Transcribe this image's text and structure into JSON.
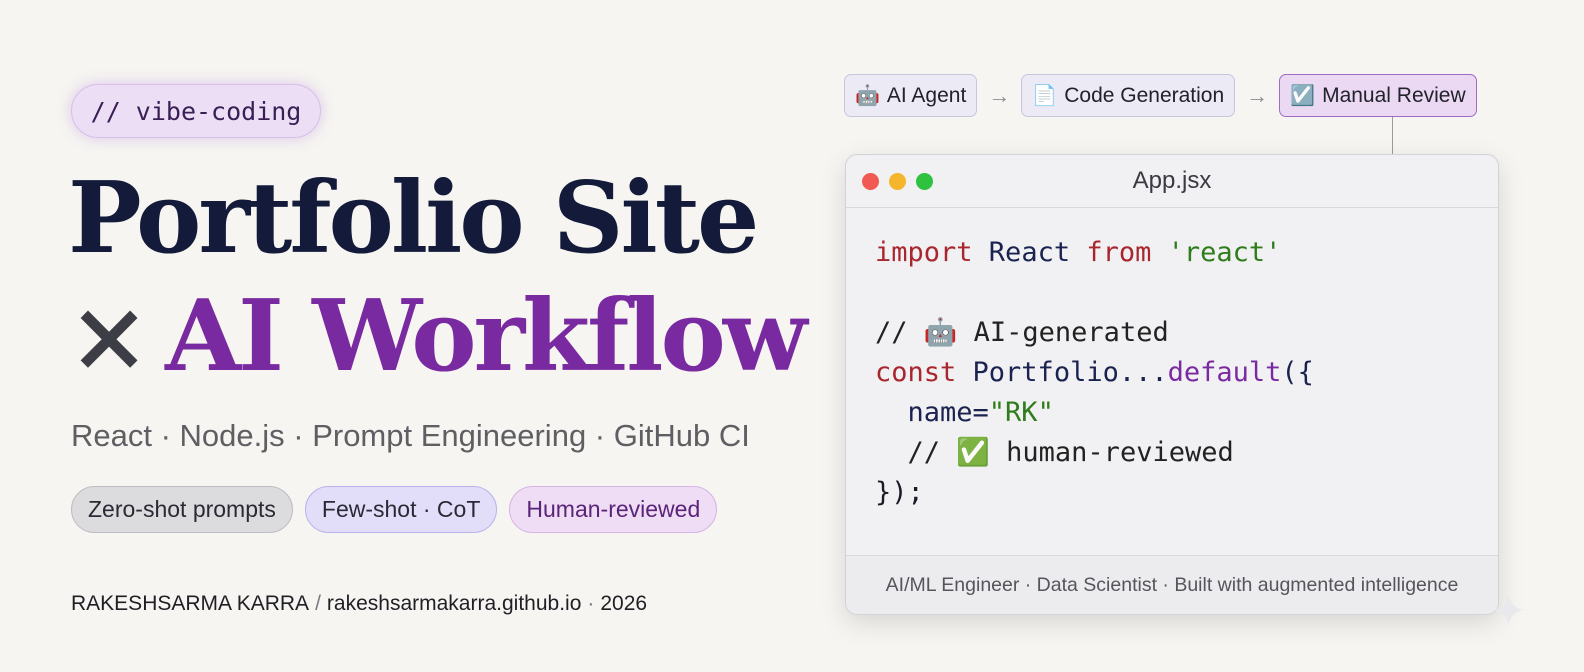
{
  "tag": "// vibe-coding",
  "title": {
    "line1": "Portfolio Site",
    "line2_prefix": "×",
    "line2_highlight": "AI Workflow"
  },
  "stack": "React · Node.js · Prompt Engineering · GitHub CI",
  "pills": [
    "Zero-shot prompts",
    "Few-shot · CoT",
    "Human-reviewed"
  ],
  "footer": {
    "name": "RAKESHSARMA KARRA",
    "slash": "/",
    "site": "rakeshsarmakarra.github.io",
    "dot": "·",
    "year": "2026"
  },
  "flow": [
    {
      "icon": "robot-icon",
      "emoji": "🤖",
      "label": "AI Agent",
      "active": false
    },
    {
      "icon": "document-icon",
      "emoji": "📄",
      "label": "Code Generation",
      "active": false
    },
    {
      "icon": "checkbox-icon",
      "emoji": "☑️",
      "label": "Manual Review",
      "active": true
    }
  ],
  "flow_arrow": "→",
  "window": {
    "filename": "App.jsx",
    "code": {
      "l1_kw": "import",
      "l1_id": " React ",
      "l1_kw2": "from",
      "l1_str": " 'react'",
      "l3_comment": "// 🤖 AI-generated",
      "l4_kw": "const",
      "l4_id": " Portfolio...",
      "l4_fn": "default",
      "l4_rest": "({",
      "l5_attr": "  name=",
      "l5_str": "\"RK\"",
      "l6_comment": "  // ✅ human-reviewed",
      "l7": "});"
    },
    "footer": "AI/ML Engineer · Data Scientist · Built with augmented intelligence"
  },
  "colors": {
    "navy": "#131a3a",
    "purple": "#7a2aa0",
    "keyword": "#a8262e",
    "string": "#2e7d1a"
  }
}
